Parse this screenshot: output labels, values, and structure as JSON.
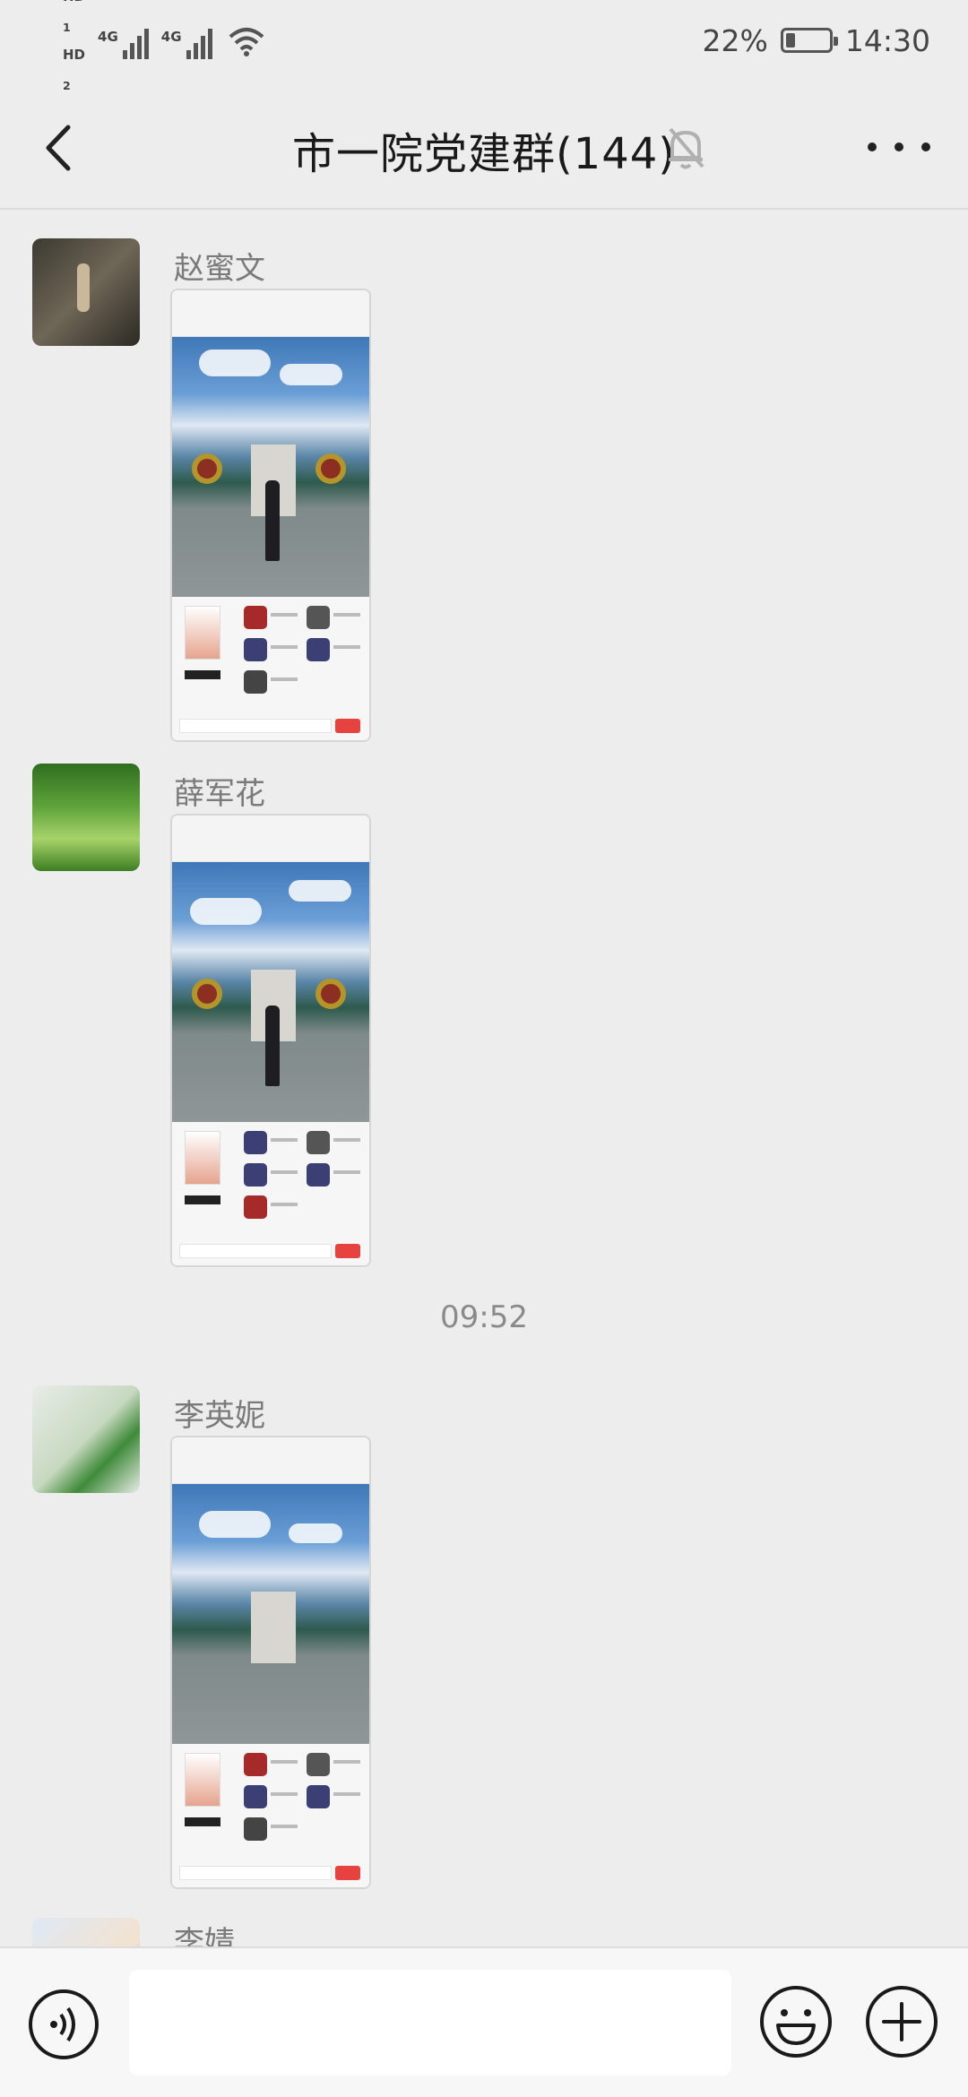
{
  "status_bar": {
    "hd1": "HD",
    "hd1_sub": "1",
    "hd2": "HD",
    "hd2_sub": "2",
    "network1": "4G",
    "network2": "4G",
    "battery_percent": "22%",
    "battery_level": 0.22,
    "time": "14:30"
  },
  "header": {
    "title": "市一院党建群(144)",
    "muted_icon": "bell-muted-icon",
    "back_icon": "chevron-left-icon",
    "more_icon": "more-dots-icon"
  },
  "messages": [
    {
      "sender": "赵蜜文",
      "type": "image"
    },
    {
      "sender": "薛军花",
      "type": "image"
    },
    {
      "sender": "李英妮",
      "type": "image"
    },
    {
      "sender": "李婧",
      "type": "image"
    }
  ],
  "time_separator": "09:52",
  "composer": {
    "voice_icon": "voice-icon",
    "emoji_icon": "emoji-icon",
    "plus_icon": "plus-icon"
  }
}
